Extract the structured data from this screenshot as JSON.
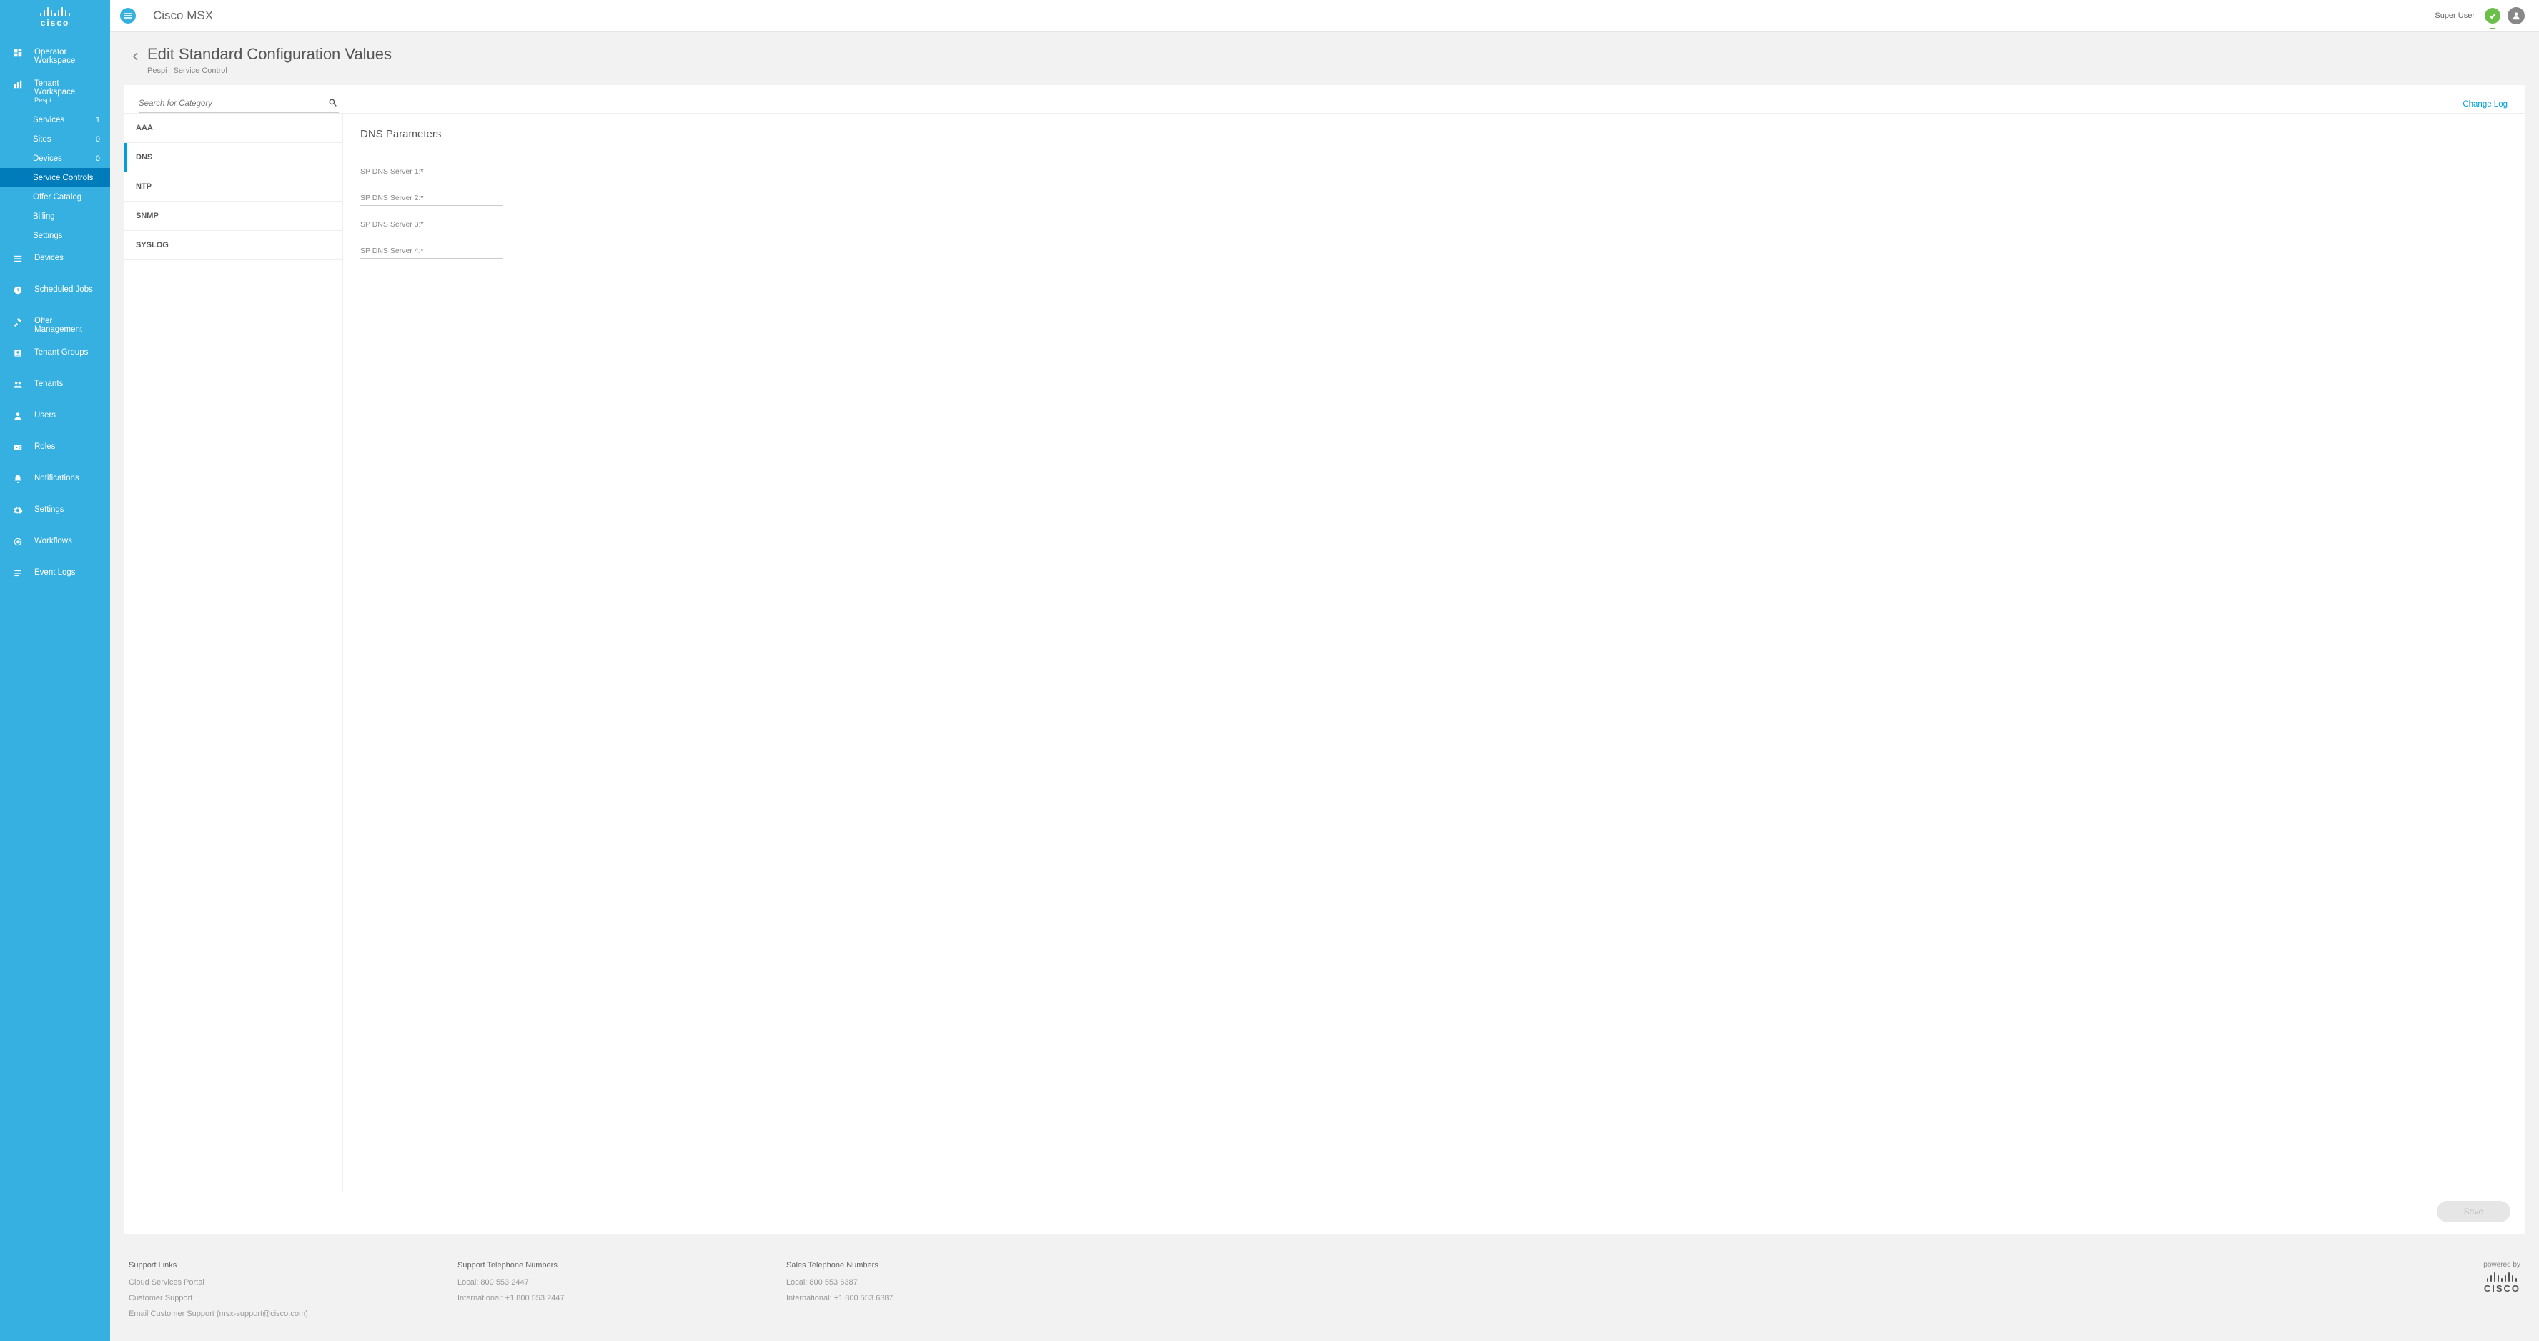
{
  "header": {
    "product": "Cisco MSX",
    "user": "Super User"
  },
  "sidebar": {
    "brand": "cisco",
    "items": [
      {
        "id": "operator-workspace",
        "label": "Operator Workspace",
        "icon": "dashboard"
      },
      {
        "id": "tenant-workspace",
        "label": "Tenant Workspace",
        "sub": "Pespi",
        "icon": "chart",
        "children": [
          {
            "id": "services",
            "label": "Services",
            "badge": "1"
          },
          {
            "id": "sites",
            "label": "Sites",
            "badge": "0"
          },
          {
            "id": "devices-sub",
            "label": "Devices",
            "badge": "0"
          },
          {
            "id": "service-controls",
            "label": "Service Controls",
            "active": true
          },
          {
            "id": "offer-catalog",
            "label": "Offer Catalog"
          },
          {
            "id": "billing",
            "label": "Billing"
          },
          {
            "id": "settings-sub",
            "label": "Settings"
          }
        ]
      },
      {
        "id": "devices",
        "label": "Devices",
        "icon": "menu"
      },
      {
        "id": "scheduled-jobs",
        "label": "Scheduled Jobs",
        "icon": "clock"
      },
      {
        "id": "offer-management",
        "label": "Offer Management",
        "icon": "tools"
      },
      {
        "id": "tenant-groups",
        "label": "Tenant Groups",
        "icon": "group"
      },
      {
        "id": "tenants",
        "label": "Tenants",
        "icon": "tenants"
      },
      {
        "id": "users",
        "label": "Users",
        "icon": "user"
      },
      {
        "id": "roles",
        "label": "Roles",
        "icon": "id"
      },
      {
        "id": "notifications",
        "label": "Notifications",
        "icon": "bell"
      },
      {
        "id": "settings",
        "label": "Settings",
        "icon": "gear"
      },
      {
        "id": "workflows",
        "label": "Workflows",
        "icon": "workflow"
      },
      {
        "id": "event-logs",
        "label": "Event Logs",
        "icon": "logs"
      }
    ]
  },
  "page": {
    "title": "Edit Standard Configuration Values",
    "crumbs": [
      "Pespi",
      "Service Control"
    ],
    "search_placeholder": "Search for Category",
    "change_log": "Change Log",
    "save_label": "Save"
  },
  "categories": [
    {
      "id": "aaa",
      "label": "AAA"
    },
    {
      "id": "dns",
      "label": "DNS",
      "active": true
    },
    {
      "id": "ntp",
      "label": "NTP"
    },
    {
      "id": "snmp",
      "label": "SNMP"
    },
    {
      "id": "syslog",
      "label": "SYSLOG"
    }
  ],
  "detail": {
    "title": "DNS Parameters",
    "fields": [
      {
        "label": "SP DNS Server 1:",
        "required": true
      },
      {
        "label": "SP DNS Server 2:",
        "required": true
      },
      {
        "label": "SP DNS Server 3:",
        "required": true
      },
      {
        "label": "SP DNS Server 4:",
        "required": true
      }
    ]
  },
  "footer": {
    "support_links_title": "Support Links",
    "support_links": [
      "Cloud Services Portal",
      "Customer Support",
      "Email Customer Support (msx-support@cisco.com)"
    ],
    "support_tel_title": "Support Telephone Numbers",
    "support_tel": [
      "Local: 800 553 2447",
      "International: +1 800 553 2447"
    ],
    "sales_tel_title": "Sales Telephone Numbers",
    "sales_tel": [
      "Local: 800 553 6387",
      "International: +1 800 553 6387"
    ],
    "powered_by": "powered by",
    "powered_brand": "CISCO"
  }
}
